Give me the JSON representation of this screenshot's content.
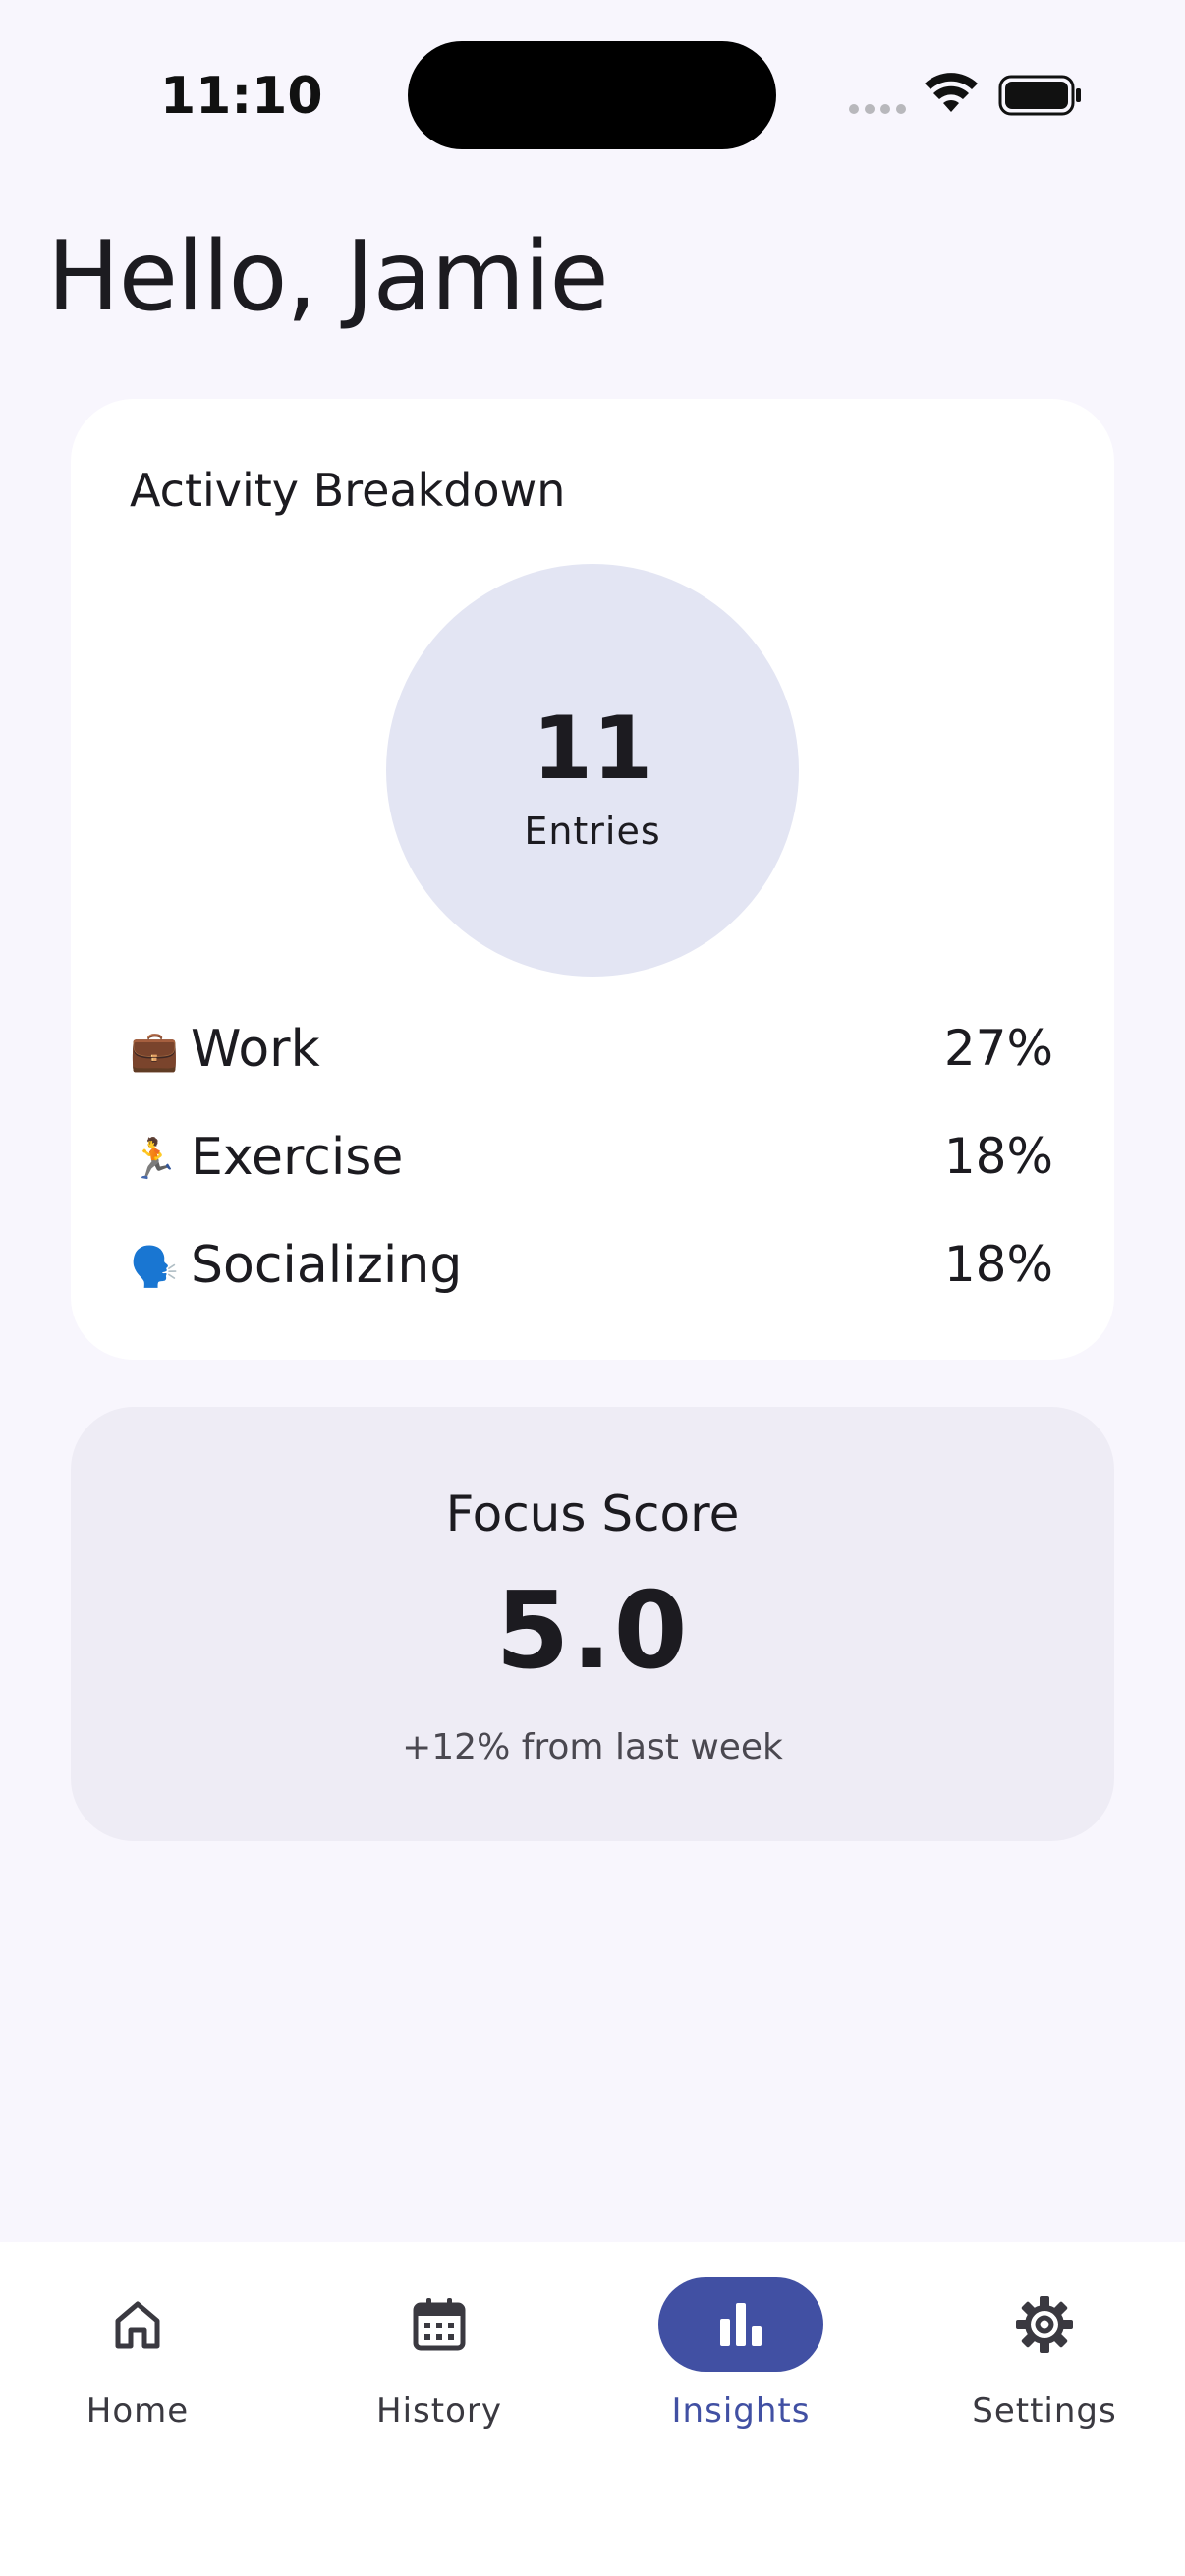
{
  "status_bar": {
    "time": "11:10"
  },
  "greeting": "Hello, Jamie",
  "activity": {
    "title": "Activity Breakdown",
    "entries_count": "11",
    "entries_label": "Entries",
    "items": [
      {
        "emoji": "💼",
        "icon": "briefcase-icon",
        "label": "Work",
        "value": "27%"
      },
      {
        "emoji": "🏃",
        "icon": "runner-icon",
        "label": "Exercise",
        "value": "18%"
      },
      {
        "emoji": "🗣️",
        "icon": "speaking-head-icon",
        "label": "Socializing",
        "value": "18%"
      }
    ]
  },
  "focus": {
    "title": "Focus Score",
    "score": "5.0",
    "change": "+12% from last week"
  },
  "nav": {
    "items": [
      {
        "label": "Home",
        "icon": "home-icon",
        "active": false
      },
      {
        "label": "History",
        "icon": "calendar-icon",
        "active": false
      },
      {
        "label": "Insights",
        "icon": "bar-chart-icon",
        "active": true
      },
      {
        "label": "Settings",
        "icon": "gear-icon",
        "active": false
      }
    ]
  },
  "colors": {
    "background": "#f8f6fd",
    "accent": "#4150a3",
    "circle_fill": "#e3e5f3",
    "focus_card": "#eeecf5"
  }
}
